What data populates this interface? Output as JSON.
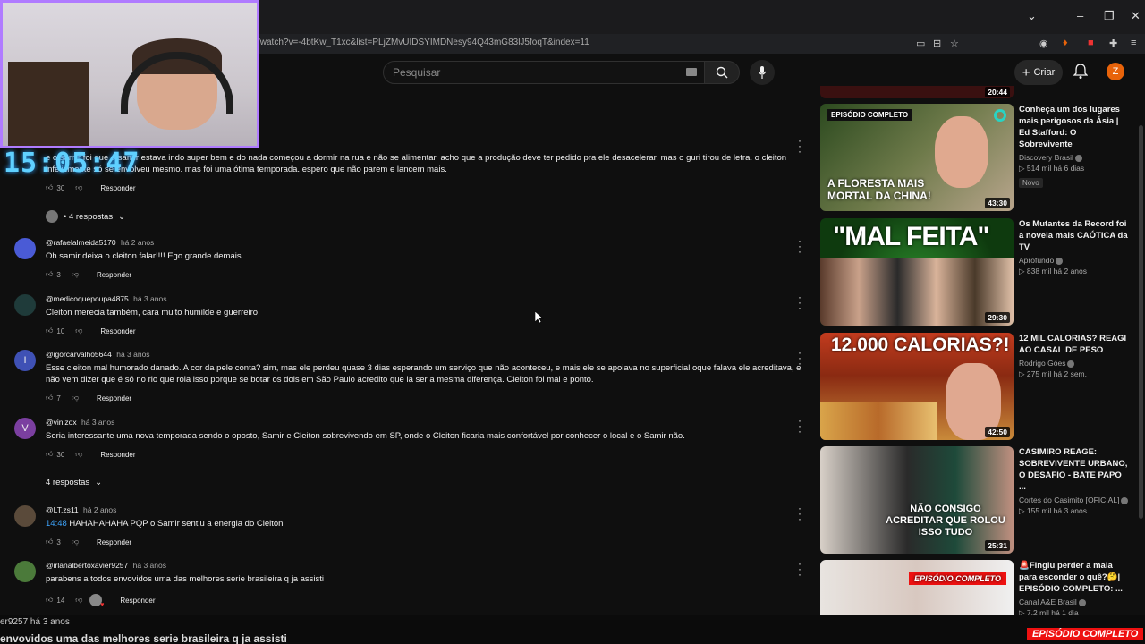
{
  "browser": {
    "url": "/watch?v=-4btKw_T1xc&list=PLjZMvUIDSYIMDNesy94Q43mG83lJ5foqT&index=11"
  },
  "header": {
    "search_placeholder": "Pesquisar",
    "create_label": "Criar",
    "avatar_letter": "Z"
  },
  "overlay": {
    "clock": "15:05:47"
  },
  "comments": [
    {
      "user": "",
      "time": "",
      "text": "e o samir foi que o samir estava indo super bem e do nada começou a dormir na rua e não se alimentar. acho que a produção deve ter pedido pra ele desacelerar. mas o guri tirou de letra. o cleiton infelizmente só se envolveu mesmo. mas foi uma ótima temporada. espero que não parem e lancem mais.",
      "likes": "30",
      "reply": "Responder",
      "replies": "• 4 respostas"
    },
    {
      "user": "@rafaelalmeida5170",
      "time": "há 2 anos",
      "text": "Oh samir deixa o cleiton falar!!!! Ego grande demais ...",
      "likes": "3",
      "reply": "Responder"
    },
    {
      "user": "@medicoquepoupa4875",
      "time": "há 3 anos",
      "text": "Cleiton merecia também, cara muito humilde e guerreiro",
      "likes": "10",
      "reply": "Responder"
    },
    {
      "user": "@igorcarvalho5644",
      "time": "há 3 anos",
      "avatar_letter": "I",
      "text": "Esse cleiton mal humorado danado. A cor da pele conta? sim, mas ele perdeu quase 3 dias esperando um serviço que não aconteceu, e mais ele se apoiava no superficial oque falava ele acreditava, e não vem dizer que é só no rio que rola isso porque se botar os dois em São Paulo acredito que ia ser a mesma diferença. Cleiton foi mal e ponto.",
      "likes": "7",
      "reply": "Responder"
    },
    {
      "user": "@vinizox",
      "time": "há 3 anos",
      "avatar_letter": "V",
      "text": "Seria interessante uma nova temporada sendo o oposto, Samir e Cleiton sobrevivendo em SP, onde o Cleiton ficaria mais confortável por conhecer o local e o Samir não.",
      "likes": "30",
      "reply": "Responder",
      "replies": "4 respostas"
    },
    {
      "user": "@LT.zs11",
      "time": "há 2 anos",
      "timestamp_link": "14:48",
      "text": "HAHAHAHAHA PQP o Samir sentiu a energia do Cleiton",
      "likes": "3",
      "reply": "Responder"
    },
    {
      "user": "@irlanalbertoxavier9257",
      "time": "há 3 anos",
      "text": "parabens a todos envovidos uma das melhores serie brasileira q ja assisti",
      "likes": "14",
      "reply": "Responder"
    }
  ],
  "videos": [
    {
      "title": "Conheça um dos lugares mais perigosos da Ásia | Ed Stafford: O Sobrevivente",
      "channel": "Discovery Brasil",
      "stats": "▷ 514 mil  há 6 dias",
      "badge": "Novo",
      "duration": "43:30",
      "thumb_top": "EPISÓDIO COMPLETO",
      "thumb_text": "A FLORESTA MAIS MORTAL DA CHINA!"
    },
    {
      "title": "Os Mutantes da Record foi a novela mais CAÓTICA da TV",
      "channel": "Aprofundo",
      "stats": "▷ 838 mil  há 2 anos",
      "duration": "29:30",
      "thumb_text": "\"MAL FEITA\""
    },
    {
      "title": "12 MIL CALORIAS? REAGI AO CASAL DE PESO",
      "channel": "Rodrigo Góes",
      "stats": "▷ 275 mil  há 2 sem.",
      "duration": "42:50",
      "thumb_text": "12.000 CALORIAS?!"
    },
    {
      "title": "CASIMIRO REAGE: SOBREVIVENTE URBANO, O DESAFIO - BATE PAPO ...",
      "channel": "Cortes do Casimito [OFICIAL]",
      "stats": "▷ 155 mil  há 3 anos",
      "duration": "25:31",
      "thumb_text": "NÃO CONSIGO ACREDITAR QUE ROLOU ISSO TUDO"
    },
    {
      "title": "🚨Fingiu perder a mala para esconder o quê?🤔| EPISÓDIO COMPLETO: ...",
      "channel": "Canal A&E Brasil",
      "stats": "▷ 7,2 mil  há 1 dia",
      "thumb_text": "EPISÓDIO COMPLETO"
    }
  ],
  "top_partial_duration": "20:44",
  "bottom_overlay": {
    "line1": "er9257 há 3 anos",
    "line2": "envovidos uma das melhores serie brasileira q ja assisti",
    "right_badge": "EPISÓDIO COMPLETO"
  },
  "colors": {
    "accent_link": "#3ea6ff",
    "avatar_z": "#e8630a",
    "webcam_border": "#b07bff",
    "clock": "#5fd0ff"
  }
}
